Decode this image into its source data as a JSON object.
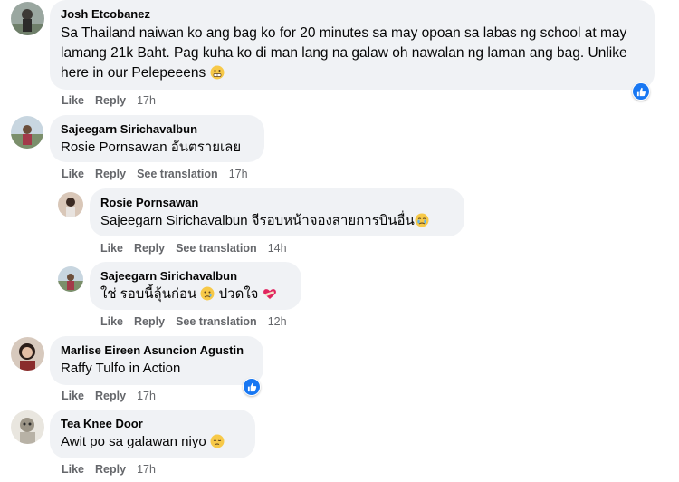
{
  "comments": [
    {
      "author": "Josh Etcobanez",
      "text": "Sa Thailand naiwan ko ang bag ko for 20 minutes sa may opoan sa labas ng school at may lamang 21k Baht. Pag kuha ko di man lang na galaw oh nawalan ng laman ang bag. Unlike here in our Pelepeeens",
      "emoji": "grimace-emoji",
      "actions": {
        "like": "Like",
        "reply": "Reply",
        "time": "17h"
      },
      "reaction": "like-icon"
    },
    {
      "author": "Sajeegarn Sirichavalbun",
      "text": "Rosie Pornsawan อันตรายเลย",
      "actions": {
        "like": "Like",
        "reply": "Reply",
        "translate": "See translation",
        "time": "17h"
      }
    },
    {
      "author": "Rosie Pornsawan",
      "text": "Sajeegarn Sirichavalbun จีรอบหน้าจองสายการบินอื่น",
      "emoji": "crying-emoji",
      "actions": {
        "like": "Like",
        "reply": "Reply",
        "translate": "See translation",
        "time": "14h"
      }
    },
    {
      "author": "Sajeegarn Sirichavalbun",
      "text_before": "ใช่ รอบนี้ลุ้นก่อน",
      "text_middle": "ปวดใจ",
      "emoji": "sad-emoji",
      "emoji2": "bandaged-heart-emoji",
      "actions": {
        "like": "Like",
        "reply": "Reply",
        "translate": "See translation",
        "time": "12h"
      }
    },
    {
      "author": "Marlise Eireen Asuncion Agustin",
      "text": "Raffy Tulfo in Action",
      "actions": {
        "like": "Like",
        "reply": "Reply",
        "time": "17h"
      },
      "reaction": "like-icon"
    },
    {
      "author": "Tea Knee Door",
      "text": "Awit po sa galawan niyo",
      "emoji": "pensive-emoji",
      "actions": {
        "like": "Like",
        "reply": "Reply",
        "time": "17h"
      }
    }
  ],
  "colors": {
    "bubble": "#f0f2f5",
    "meta": "#65676b",
    "like_blue": "#1877f2"
  }
}
